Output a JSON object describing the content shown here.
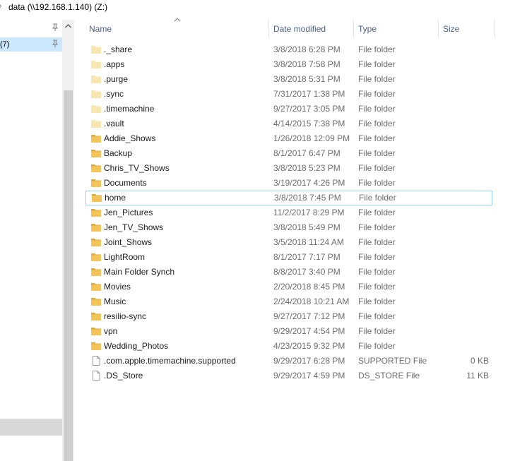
{
  "address": {
    "path": "data (\\\\192.168.1.140) (Z:)"
  },
  "nav": {
    "items": [
      {
        "label": "",
        "selected": false
      },
      {
        "label": "(7)",
        "selected": true
      }
    ]
  },
  "columns": {
    "name": "Name",
    "date": "Date modified",
    "type": "Type",
    "size": "Size"
  },
  "colors": {
    "folder": "#f3c559",
    "folder_dark": "#e0a93b",
    "folder_hidden": "#f8e4a8",
    "selection": "#cce8ff",
    "focus_border": "#99d1ff",
    "header_text": "#4d6082"
  },
  "files": [
    {
      "name": "._share",
      "date": "3/8/2018 6:28 PM",
      "type": "File folder",
      "size": "",
      "icon": "folder-hidden-icon"
    },
    {
      "name": ".apps",
      "date": "3/8/2018 7:58 PM",
      "type": "File folder",
      "size": "",
      "icon": "folder-hidden-icon"
    },
    {
      "name": ".purge",
      "date": "3/8/2018 5:31 PM",
      "type": "File folder",
      "size": "",
      "icon": "folder-hidden-icon"
    },
    {
      "name": ".sync",
      "date": "7/31/2017 1:38 PM",
      "type": "File folder",
      "size": "",
      "icon": "folder-hidden-icon"
    },
    {
      "name": ".timemachine",
      "date": "9/27/2017 3:05 PM",
      "type": "File folder",
      "size": "",
      "icon": "folder-hidden-icon"
    },
    {
      "name": ".vault",
      "date": "4/14/2015 7:38 PM",
      "type": "File folder",
      "size": "",
      "icon": "folder-hidden-icon"
    },
    {
      "name": "Addie_Shows",
      "date": "1/26/2018 12:09 PM",
      "type": "File folder",
      "size": "",
      "icon": "folder-icon"
    },
    {
      "name": "Backup",
      "date": "8/1/2017 6:47 PM",
      "type": "File folder",
      "size": "",
      "icon": "folder-icon"
    },
    {
      "name": "Chris_TV_Shows",
      "date": "3/8/2018 5:23 PM",
      "type": "File folder",
      "size": "",
      "icon": "folder-icon"
    },
    {
      "name": "Documents",
      "date": "3/19/2017 4:26 PM",
      "type": "File folder",
      "size": "",
      "icon": "folder-icon"
    },
    {
      "name": "home",
      "date": "3/8/2018 7:45 PM",
      "type": "File folder",
      "size": "",
      "icon": "folder-icon",
      "focused": true
    },
    {
      "name": "Jen_Pictures",
      "date": "11/2/2017 8:29 PM",
      "type": "File folder",
      "size": "",
      "icon": "folder-icon"
    },
    {
      "name": "Jen_TV_Shows",
      "date": "3/8/2018 5:49 PM",
      "type": "File folder",
      "size": "",
      "icon": "folder-icon"
    },
    {
      "name": "Joint_Shows",
      "date": "3/5/2018 11:24 AM",
      "type": "File folder",
      "size": "",
      "icon": "folder-icon"
    },
    {
      "name": "LightRoom",
      "date": "8/1/2017 7:17 PM",
      "type": "File folder",
      "size": "",
      "icon": "folder-icon"
    },
    {
      "name": "Main Folder Synch",
      "date": "8/8/2017 3:40 PM",
      "type": "File folder",
      "size": "",
      "icon": "folder-icon"
    },
    {
      "name": "Movies",
      "date": "2/20/2018 8:45 PM",
      "type": "File folder",
      "size": "",
      "icon": "folder-icon"
    },
    {
      "name": "Music",
      "date": "2/24/2018 10:21 AM",
      "type": "File folder",
      "size": "",
      "icon": "folder-icon"
    },
    {
      "name": "resilio-sync",
      "date": "9/27/2017 7:12 PM",
      "type": "File folder",
      "size": "",
      "icon": "folder-icon"
    },
    {
      "name": "vpn",
      "date": "9/29/2017 4:54 PM",
      "type": "File folder",
      "size": "",
      "icon": "folder-icon"
    },
    {
      "name": "Wedding_Photos",
      "date": "4/23/2015 9:32 PM",
      "type": "File folder",
      "size": "",
      "icon": "folder-icon"
    },
    {
      "name": ".com.apple.timemachine.supported",
      "date": "9/29/2017 6:28 PM",
      "type": "SUPPORTED File",
      "size": "0 KB",
      "icon": "file-icon"
    },
    {
      "name": ".DS_Store",
      "date": "9/29/2017 4:59 PM",
      "type": "DS_STORE File",
      "size": "11 KB",
      "icon": "file-icon"
    }
  ]
}
